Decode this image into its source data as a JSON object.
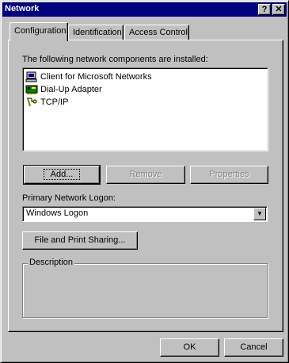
{
  "window": {
    "title": "Network",
    "help_label": "?",
    "close_label": "✕"
  },
  "tabs": [
    {
      "label": "Configuration",
      "active": true
    },
    {
      "label": "Identification",
      "active": false
    },
    {
      "label": "Access Control",
      "active": false
    }
  ],
  "components": {
    "heading": "The following network components are installed:",
    "items": [
      {
        "label": "Client for Microsoft Networks",
        "icon": "network-client-icon"
      },
      {
        "label": "Dial-Up Adapter",
        "icon": "network-adapter-icon"
      },
      {
        "label": "TCP/IP",
        "icon": "network-protocol-icon"
      }
    ],
    "add_label": "Add...",
    "remove_label": "Remove",
    "properties_label": "Properties"
  },
  "logon": {
    "label": "Primary Network Logon:",
    "value": "Windows Logon"
  },
  "file_print_label": "File and Print Sharing...",
  "description": {
    "legend": "Description"
  },
  "footer": {
    "ok_label": "OK",
    "cancel_label": "Cancel"
  }
}
